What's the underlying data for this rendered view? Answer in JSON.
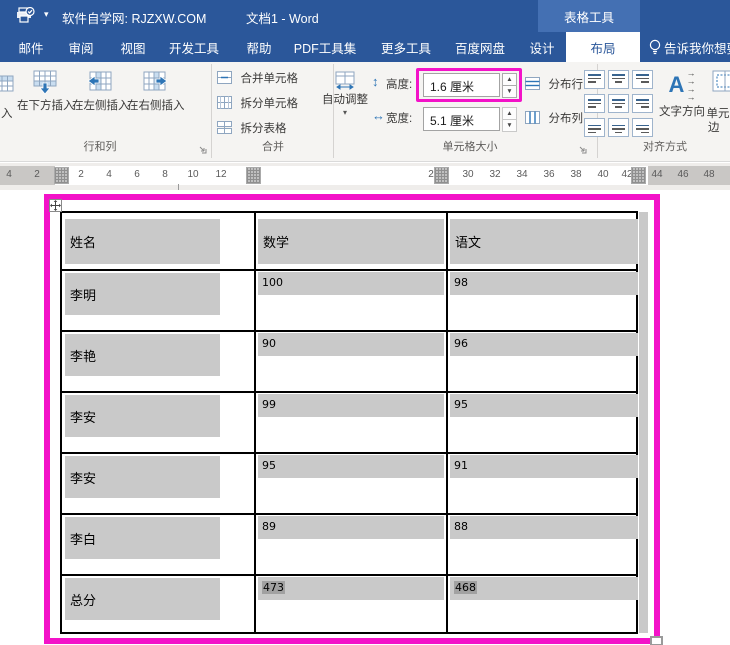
{
  "titlebar": {
    "app_title": "软件自学网: RJZXW.COM",
    "doc_title": "文档1 - Word",
    "contextual_title": "表格工具"
  },
  "tabs": {
    "items": [
      "邮件",
      "审阅",
      "视图",
      "开发工具",
      "帮助",
      "PDF工具集",
      "更多工具",
      "百度网盘",
      "设计",
      "布局"
    ],
    "active": "布局",
    "tell_me": "告诉我你想要"
  },
  "ribbon": {
    "rows_cols": {
      "partial_button": "入",
      "insert_below": "在下方插入",
      "insert_left": "在左侧插入",
      "insert_right": "在右侧插入",
      "group": "行和列"
    },
    "merge": {
      "merge_cells": "合并单元格",
      "split_cells": "拆分单元格",
      "split_table": "拆分表格",
      "group": "合并"
    },
    "cell_size": {
      "autofit": "自动调整",
      "height_label": "高度:",
      "height_value": "1.6 厘米",
      "width_label": "宽度:",
      "width_value": "5.1 厘米",
      "distribute_rows": "分布行",
      "distribute_columns": "分布列",
      "group": "单元格大小"
    },
    "alignment": {
      "text_direction": "文字方向",
      "cell_margins_line1": "单元",
      "cell_margins_line2": "边",
      "group": "对齐方式"
    }
  },
  "ruler": {
    "left": [
      "4",
      "2"
    ],
    "mid": [
      "2",
      "4",
      "6",
      "8",
      "10",
      "12"
    ],
    "partial": "2",
    "right": [
      "30",
      "32",
      "34",
      "36",
      "38",
      "40",
      "42"
    ],
    "outer": [
      "44",
      "46",
      "48"
    ]
  },
  "table": {
    "headers": [
      "姓名",
      "数学",
      "语文"
    ],
    "rows": [
      [
        "李明",
        "100",
        "98"
      ],
      [
        "李艳",
        "90",
        "96"
      ],
      [
        "李安",
        "99",
        "95"
      ],
      [
        "李安",
        "95",
        "91"
      ],
      [
        "李白",
        "89",
        "88"
      ],
      [
        "总分",
        "473",
        "468"
      ]
    ]
  },
  "colors": {
    "title_blue": "#2b579a",
    "contextual_blue": "#4470b3",
    "highlight_magenta": "#f312c8",
    "selection_gray": "#c9c9c9",
    "field_shading_gray": "#a1a1a1"
  }
}
